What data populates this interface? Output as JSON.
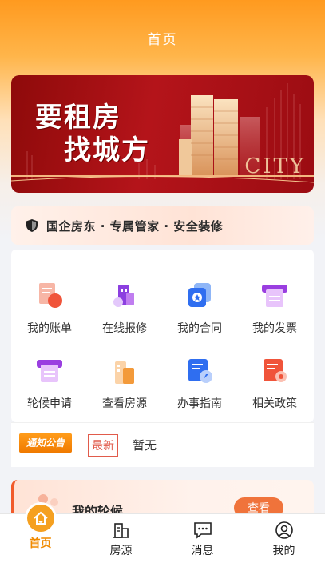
{
  "header": {
    "title": "首页"
  },
  "banner": {
    "line1": "要租房",
    "line2": "找城方",
    "city_text": "CITY"
  },
  "slogan": {
    "text": "国企房东 · 专属管家 · 安全装修",
    "icon": "shield-icon"
  },
  "grid": {
    "items": [
      {
        "label": "我的账单",
        "icon": "bill-icon",
        "color": "#f06a4b"
      },
      {
        "label": "在线报修",
        "icon": "repair-icon",
        "color": "#a24be0"
      },
      {
        "label": "我的合同",
        "icon": "contract-icon",
        "color": "#2f7cf0"
      },
      {
        "label": "我的发票",
        "icon": "invoice-icon",
        "color": "#b457e8"
      },
      {
        "label": "轮候申请",
        "icon": "queue-apply-icon",
        "color": "#b457e8"
      },
      {
        "label": "查看房源",
        "icon": "building-icon",
        "color": "#f39a3a"
      },
      {
        "label": "办事指南",
        "icon": "guide-icon",
        "color": "#2f6ef0"
      },
      {
        "label": "相关政策",
        "icon": "policy-icon",
        "color": "#f06a4b"
      }
    ]
  },
  "notice": {
    "tag": "通知公告",
    "badge": "最新",
    "text": "暂无"
  },
  "queue": {
    "title": "我的轮候",
    "button": "查看"
  },
  "tabbar": {
    "items": [
      {
        "label": "首页",
        "icon": "home-icon",
        "active": true
      },
      {
        "label": "房源",
        "icon": "house-icon"
      },
      {
        "label": "消息",
        "icon": "message-icon"
      },
      {
        "label": "我的",
        "icon": "user-icon"
      }
    ],
    "accent": "#f08a00"
  }
}
